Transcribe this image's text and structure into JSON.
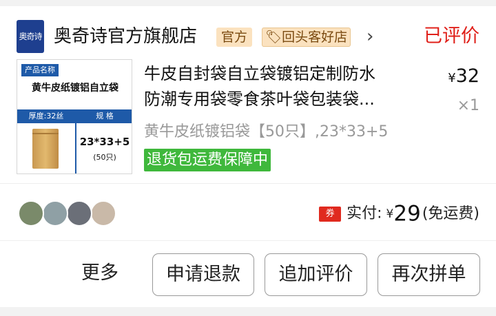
{
  "shop": {
    "logo_text": "奥奇诗",
    "name": "奥奇诗官方旗舰店",
    "badge_official": "官方",
    "badge_good": "回头客好店",
    "status": "已评价"
  },
  "product": {
    "image": {
      "tag": "产品名称",
      "title": "黄牛皮纸镀铝自立袋",
      "thickness": "厚度:32丝",
      "spec_label": "规 格",
      "size": "23*33+5",
      "qty": "(50只)"
    },
    "title_line1": "牛皮自封袋自立袋镀铝定制防水",
    "title_line2": "防潮专用袋零食茶叶袋包装袋...",
    "price_symbol": "¥",
    "price": "32",
    "quantity": "×1",
    "sku": "黄牛皮纸镀铝袋【50只】,23*33+5",
    "guarantee": "退货包运费保障中"
  },
  "payment": {
    "coupon_icon": "券",
    "label": "实付:",
    "symbol": "¥",
    "amount": "29",
    "shipping": "(免运费)"
  },
  "avatars": [
    {
      "color": "#7a8a6a"
    },
    {
      "color": "#8fa0a5"
    },
    {
      "color": "#6b6f78"
    },
    {
      "color": "#c9b9a8"
    }
  ],
  "actions": {
    "more": "更多",
    "refund": "申请退款",
    "add_review": "追加评价",
    "rebuy": "再次拼单"
  }
}
